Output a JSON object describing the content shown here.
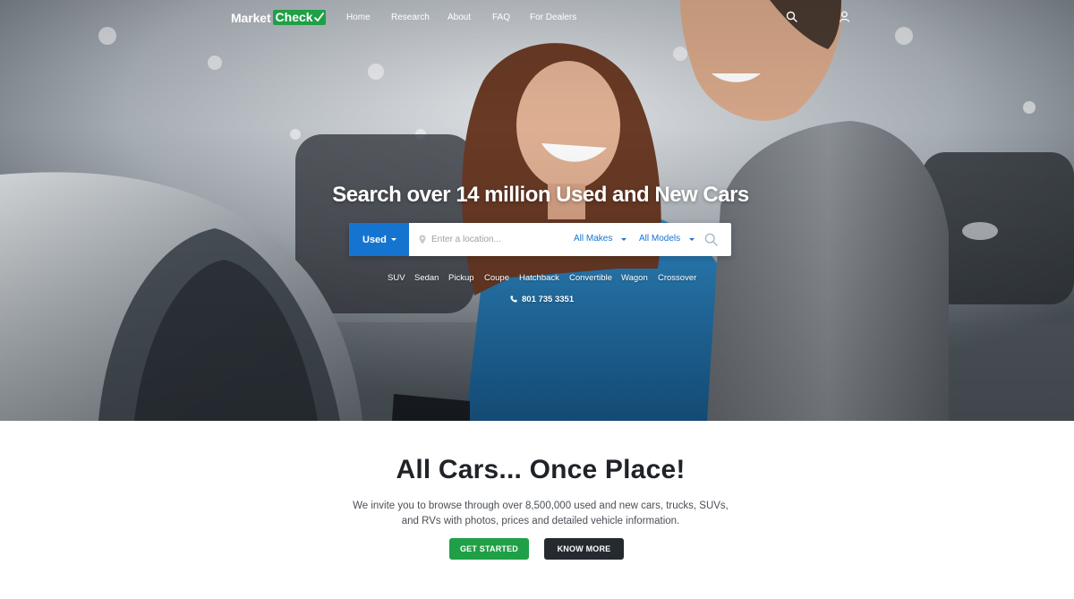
{
  "brand": {
    "name_part1": "Market",
    "name_part2": "Check",
    "green": "#1fa046",
    "blue": "#1674d1",
    "dark": "#252a30"
  },
  "nav": {
    "links": [
      "Home",
      "Research",
      "About",
      "FAQ",
      "For Dealers"
    ],
    "icons": [
      "search-icon",
      "user-icon"
    ]
  },
  "hero": {
    "headline": "Search over 14 million Used and New Cars",
    "photo": "couple smiling beside a silver car in a dealership showroom"
  },
  "search": {
    "condition": "Used",
    "location_placeholder": "Enter a location...",
    "make": "All Makes",
    "model": "All Models"
  },
  "body_types": [
    "SUV",
    "Sedan",
    "Pickup",
    "Coupe",
    "Hatchback",
    "Convertible",
    "Wagon",
    "Crossover"
  ],
  "phone": "801 735 3351",
  "section": {
    "title": "All Cars... Once Place!",
    "text_line1": "We invite you to browse through over 8,500,000 used and new cars, trucks, SUVs,",
    "text_line2": "and RVs with photos, prices and detailed vehicle information.",
    "get_started": "GET STARTED",
    "know_more": "KNOW MORE"
  }
}
